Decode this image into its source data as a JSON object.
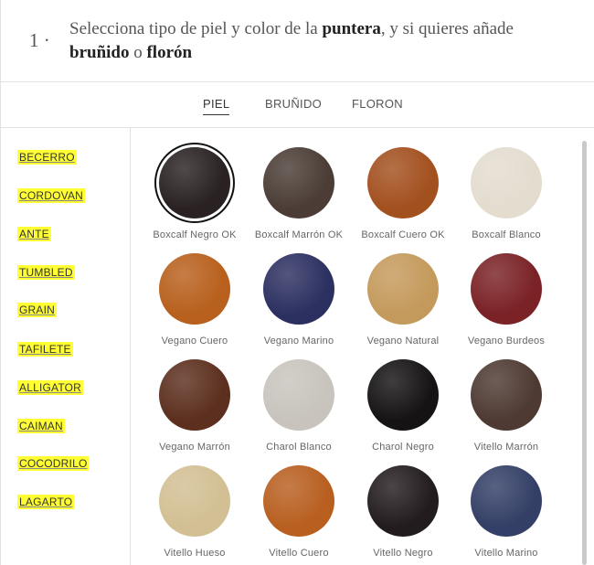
{
  "step": {
    "number": "1 ·",
    "text_prefix": "Selecciona tipo de piel y color de la",
    "text_bold1": "puntera",
    "text_middle": ", y si quieres añade",
    "text_bold2": "bruñido",
    "text_or": "o",
    "text_bold3": "florón"
  },
  "tabs": [
    {
      "label": "PIEL",
      "active": true
    },
    {
      "label": "BRUÑIDO",
      "active": false
    },
    {
      "label": "FLORON",
      "active": false
    }
  ],
  "sidebar": {
    "items": [
      {
        "label": "BECERRO"
      },
      {
        "label": "CORDOVAN"
      },
      {
        "label": "ANTE"
      },
      {
        "label": "TUMBLED"
      },
      {
        "label": "GRAIN"
      },
      {
        "label": "TAFILETE"
      },
      {
        "label": "ALLIGATOR"
      },
      {
        "label": "CAIMAN"
      },
      {
        "label": "COCODRILO"
      },
      {
        "label": "LAGARTO"
      }
    ]
  },
  "swatches": [
    {
      "label": "Boxcalf Negro OK",
      "color": "#2a2222",
      "selected": true
    },
    {
      "label": "Boxcalf Marrón OK",
      "color": "#4b3d36"
    },
    {
      "label": "Boxcalf Cuero OK",
      "color": "#a3501f"
    },
    {
      "label": "Boxcalf Blanco",
      "color": "#e3dccf"
    },
    {
      "label": "Vegano Cuero",
      "color": "#b8601d"
    },
    {
      "label": "Vegano Marino",
      "color": "#2c3060"
    },
    {
      "label": "Vegano Natural",
      "color": "#c49a5c"
    },
    {
      "label": "Vegano Burdeos",
      "color": "#7a2226"
    },
    {
      "label": "Vegano Marrón",
      "color": "#5c2f1e"
    },
    {
      "label": "Charol Blanco",
      "color": "#c8c4bd"
    },
    {
      "label": "Charol Negro",
      "color": "#151313"
    },
    {
      "label": "Vitello Marrón",
      "color": "#4e3a33"
    },
    {
      "label": "Vitello Hueso",
      "color": "#d2bf93"
    },
    {
      "label": "Vitello Cuero",
      "color": "#b85f20"
    },
    {
      "label": "Vitello Negro",
      "color": "#231c1e"
    },
    {
      "label": "Vitello Marino",
      "color": "#333f66"
    }
  ],
  "colors": {
    "highlight": "#ffff33",
    "border": "#e2e2e2"
  }
}
